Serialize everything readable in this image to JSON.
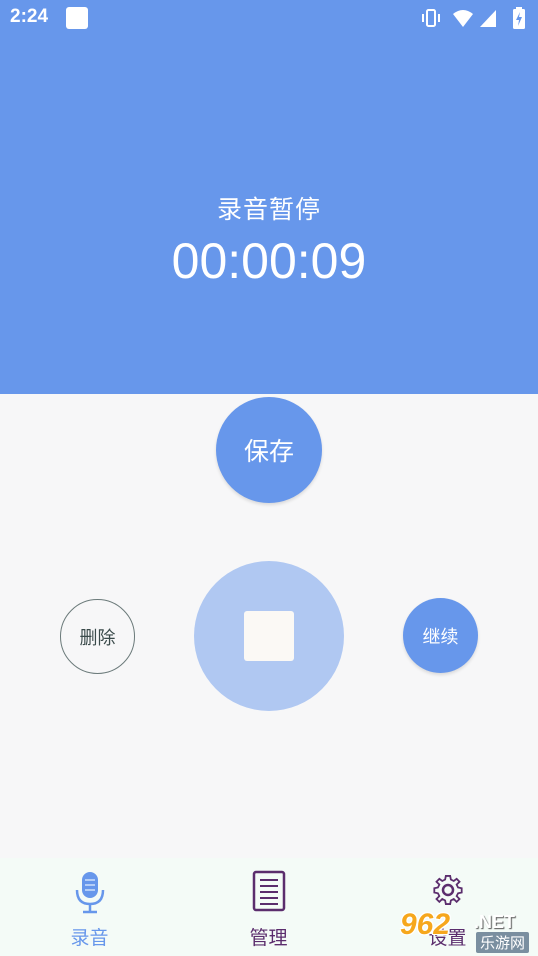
{
  "status_bar": {
    "time": "2:24",
    "icons": [
      "notification-square-icon",
      "vibrate-icon",
      "wifi-icon",
      "cellular-signal-icon",
      "battery-charging-icon"
    ]
  },
  "recorder": {
    "state_label": "录音暂停",
    "elapsed": "00:00:09"
  },
  "controls": {
    "save_label": "保存",
    "delete_label": "删除",
    "continue_label": "继续",
    "stop_icon": "stop-square-icon"
  },
  "bottom_nav": {
    "items": [
      {
        "label": "录音",
        "icon": "microphone-icon",
        "active": true
      },
      {
        "label": "管理",
        "icon": "document-list-icon",
        "active": false
      },
      {
        "label": "设置",
        "icon": "gear-icon",
        "active": false
      }
    ]
  },
  "watermark": {
    "number": "962",
    "domain": ".NET",
    "name": "乐游网"
  },
  "colors": {
    "primary": "#6797eb",
    "stop_button": "#b0c8f2",
    "nav_active": "#6797eb",
    "nav_inactive": "#5b2d6d",
    "background": "#f7f7f8"
  }
}
